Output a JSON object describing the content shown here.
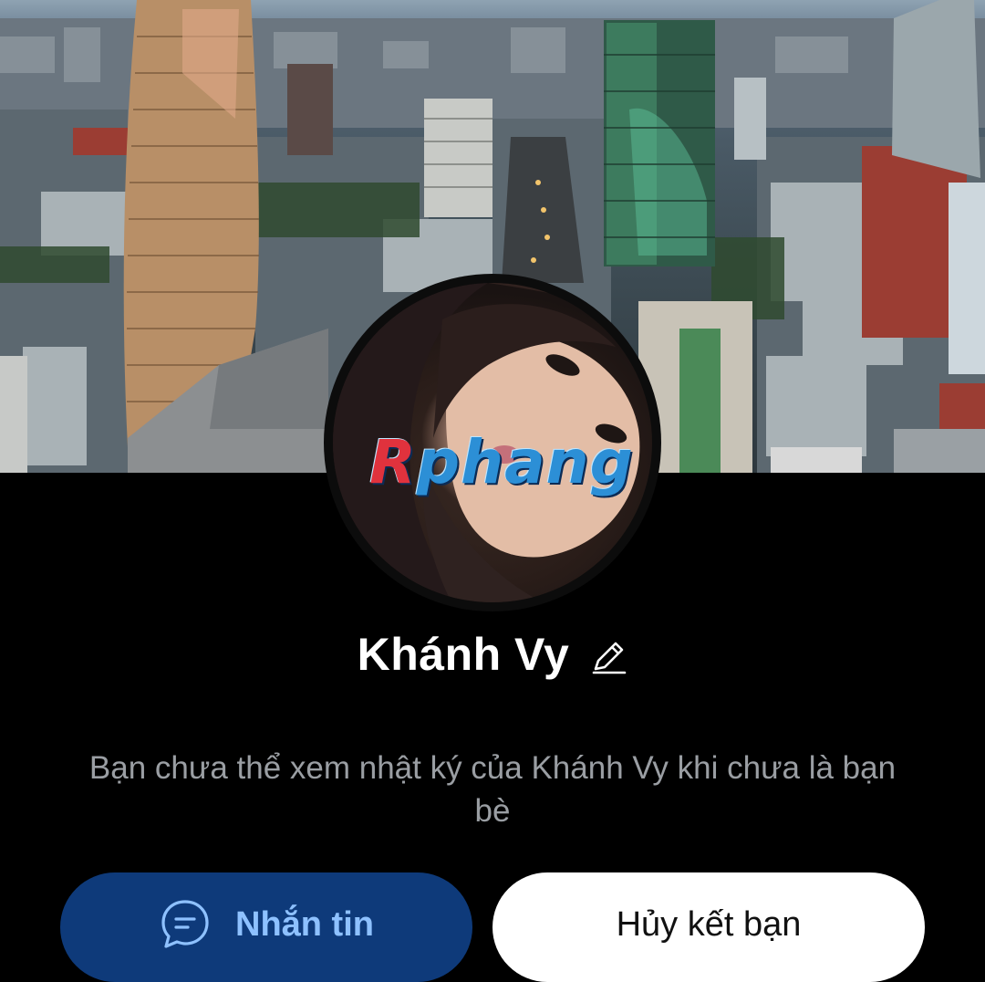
{
  "profile": {
    "name": "Khánh Vy",
    "watermark": "Rphang"
  },
  "notice": {
    "text": "Bạn chưa thể xem nhật ký của Khánh Vy khi chưa là bạn bè"
  },
  "actions": {
    "message_label": "Nhắn tin",
    "unfriend_label": "Hủy kết bạn"
  },
  "icons": {
    "edit": "pencil-icon",
    "message": "chat-bubble-icon"
  },
  "colors": {
    "background": "#000000",
    "message_button": "#0e3a7a",
    "message_text": "#8ec1ff",
    "unfriend_button": "#ffffff",
    "notice_text": "#9a9ea3"
  }
}
